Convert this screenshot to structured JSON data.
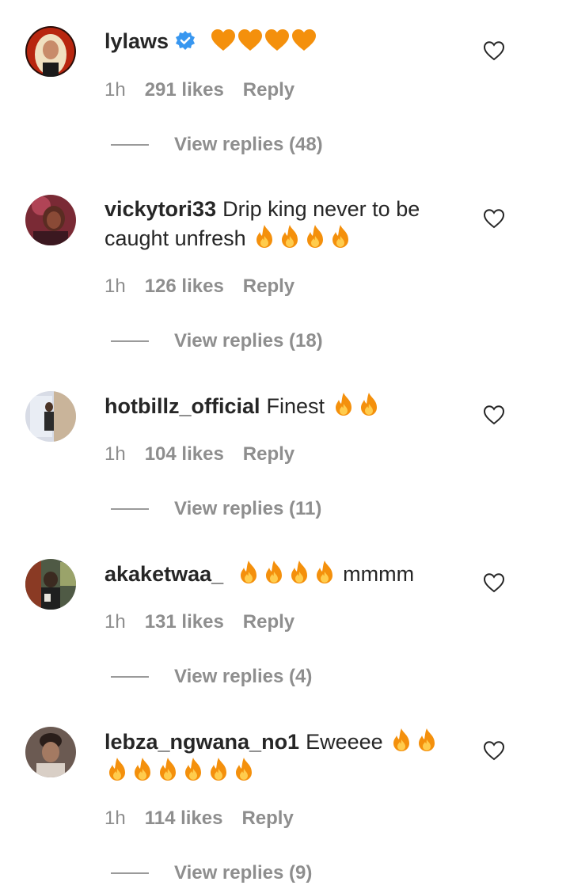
{
  "comments": [
    {
      "username": "lylaws",
      "verified": true,
      "text": "",
      "emoji_line1": [
        "orange-heart",
        "orange-heart",
        "orange-heart",
        "orange-heart"
      ],
      "time": "1h",
      "likes": "291 likes",
      "reply": "Reply",
      "view_replies": "View replies (48)"
    },
    {
      "username": "vickytori33",
      "verified": false,
      "text": "Drip king never to be caught unfresh",
      "emoji_line1": [
        "fire",
        "fire",
        "fire",
        "fire"
      ],
      "time": "1h",
      "likes": "126 likes",
      "reply": "Reply",
      "view_replies": "View replies (18)"
    },
    {
      "username": "hotbillz_official",
      "verified": false,
      "text": "Finest",
      "emoji_line1": [
        "fire",
        "fire"
      ],
      "time": "1h",
      "likes": "104 likes",
      "reply": "Reply",
      "view_replies": "View replies (11)"
    },
    {
      "username": "akaketwaa_",
      "verified": false,
      "text": "mmmm",
      "emoji_line1": [
        "fire",
        "fire",
        "fire",
        "fire"
      ],
      "time": "1h",
      "likes": "131 likes",
      "reply": "Reply",
      "view_replies": "View replies (4)"
    },
    {
      "username": "lebza_ngwana_no1",
      "verified": false,
      "text": "Eweeee",
      "emoji_line1": [
        "fire",
        "fire",
        "fire",
        "fire",
        "fire",
        "fire",
        "fire",
        "fire"
      ],
      "time": "1h",
      "likes": "114 likes",
      "reply": "Reply",
      "view_replies": "View replies (9)"
    }
  ],
  "colors": {
    "text": "#262626",
    "meta": "#8e8e8e",
    "verified_blue": "#3897f0",
    "orange_heart": "#f4900c",
    "fire_outer": "#f4900c",
    "fire_inner": "#ffcc4d"
  },
  "icons": {
    "like": "heart-outline-icon",
    "verified": "verified-badge-icon"
  }
}
